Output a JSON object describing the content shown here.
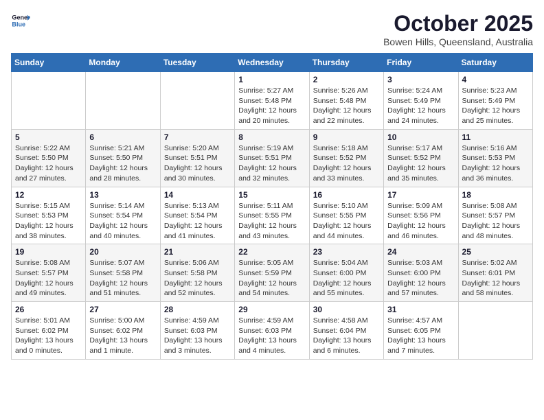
{
  "logo": {
    "line1": "General",
    "line2": "Blue"
  },
  "title": "October 2025",
  "subtitle": "Bowen Hills, Queensland, Australia",
  "days_of_week": [
    "Sunday",
    "Monday",
    "Tuesday",
    "Wednesday",
    "Thursday",
    "Friday",
    "Saturday"
  ],
  "weeks": [
    [
      {
        "day": "",
        "info": ""
      },
      {
        "day": "",
        "info": ""
      },
      {
        "day": "",
        "info": ""
      },
      {
        "day": "1",
        "info": "Sunrise: 5:27 AM\nSunset: 5:48 PM\nDaylight: 12 hours\nand 20 minutes."
      },
      {
        "day": "2",
        "info": "Sunrise: 5:26 AM\nSunset: 5:48 PM\nDaylight: 12 hours\nand 22 minutes."
      },
      {
        "day": "3",
        "info": "Sunrise: 5:24 AM\nSunset: 5:49 PM\nDaylight: 12 hours\nand 24 minutes."
      },
      {
        "day": "4",
        "info": "Sunrise: 5:23 AM\nSunset: 5:49 PM\nDaylight: 12 hours\nand 25 minutes."
      }
    ],
    [
      {
        "day": "5",
        "info": "Sunrise: 5:22 AM\nSunset: 5:50 PM\nDaylight: 12 hours\nand 27 minutes."
      },
      {
        "day": "6",
        "info": "Sunrise: 5:21 AM\nSunset: 5:50 PM\nDaylight: 12 hours\nand 28 minutes."
      },
      {
        "day": "7",
        "info": "Sunrise: 5:20 AM\nSunset: 5:51 PM\nDaylight: 12 hours\nand 30 minutes."
      },
      {
        "day": "8",
        "info": "Sunrise: 5:19 AM\nSunset: 5:51 PM\nDaylight: 12 hours\nand 32 minutes."
      },
      {
        "day": "9",
        "info": "Sunrise: 5:18 AM\nSunset: 5:52 PM\nDaylight: 12 hours\nand 33 minutes."
      },
      {
        "day": "10",
        "info": "Sunrise: 5:17 AM\nSunset: 5:52 PM\nDaylight: 12 hours\nand 35 minutes."
      },
      {
        "day": "11",
        "info": "Sunrise: 5:16 AM\nSunset: 5:53 PM\nDaylight: 12 hours\nand 36 minutes."
      }
    ],
    [
      {
        "day": "12",
        "info": "Sunrise: 5:15 AM\nSunset: 5:53 PM\nDaylight: 12 hours\nand 38 minutes."
      },
      {
        "day": "13",
        "info": "Sunrise: 5:14 AM\nSunset: 5:54 PM\nDaylight: 12 hours\nand 40 minutes."
      },
      {
        "day": "14",
        "info": "Sunrise: 5:13 AM\nSunset: 5:54 PM\nDaylight: 12 hours\nand 41 minutes."
      },
      {
        "day": "15",
        "info": "Sunrise: 5:11 AM\nSunset: 5:55 PM\nDaylight: 12 hours\nand 43 minutes."
      },
      {
        "day": "16",
        "info": "Sunrise: 5:10 AM\nSunset: 5:55 PM\nDaylight: 12 hours\nand 44 minutes."
      },
      {
        "day": "17",
        "info": "Sunrise: 5:09 AM\nSunset: 5:56 PM\nDaylight: 12 hours\nand 46 minutes."
      },
      {
        "day": "18",
        "info": "Sunrise: 5:08 AM\nSunset: 5:57 PM\nDaylight: 12 hours\nand 48 minutes."
      }
    ],
    [
      {
        "day": "19",
        "info": "Sunrise: 5:08 AM\nSunset: 5:57 PM\nDaylight: 12 hours\nand 49 minutes."
      },
      {
        "day": "20",
        "info": "Sunrise: 5:07 AM\nSunset: 5:58 PM\nDaylight: 12 hours\nand 51 minutes."
      },
      {
        "day": "21",
        "info": "Sunrise: 5:06 AM\nSunset: 5:58 PM\nDaylight: 12 hours\nand 52 minutes."
      },
      {
        "day": "22",
        "info": "Sunrise: 5:05 AM\nSunset: 5:59 PM\nDaylight: 12 hours\nand 54 minutes."
      },
      {
        "day": "23",
        "info": "Sunrise: 5:04 AM\nSunset: 6:00 PM\nDaylight: 12 hours\nand 55 minutes."
      },
      {
        "day": "24",
        "info": "Sunrise: 5:03 AM\nSunset: 6:00 PM\nDaylight: 12 hours\nand 57 minutes."
      },
      {
        "day": "25",
        "info": "Sunrise: 5:02 AM\nSunset: 6:01 PM\nDaylight: 12 hours\nand 58 minutes."
      }
    ],
    [
      {
        "day": "26",
        "info": "Sunrise: 5:01 AM\nSunset: 6:02 PM\nDaylight: 13 hours\nand 0 minutes."
      },
      {
        "day": "27",
        "info": "Sunrise: 5:00 AM\nSunset: 6:02 PM\nDaylight: 13 hours\nand 1 minute."
      },
      {
        "day": "28",
        "info": "Sunrise: 4:59 AM\nSunset: 6:03 PM\nDaylight: 13 hours\nand 3 minutes."
      },
      {
        "day": "29",
        "info": "Sunrise: 4:59 AM\nSunset: 6:03 PM\nDaylight: 13 hours\nand 4 minutes."
      },
      {
        "day": "30",
        "info": "Sunrise: 4:58 AM\nSunset: 6:04 PM\nDaylight: 13 hours\nand 6 minutes."
      },
      {
        "day": "31",
        "info": "Sunrise: 4:57 AM\nSunset: 6:05 PM\nDaylight: 13 hours\nand 7 minutes."
      },
      {
        "day": "",
        "info": ""
      }
    ]
  ]
}
